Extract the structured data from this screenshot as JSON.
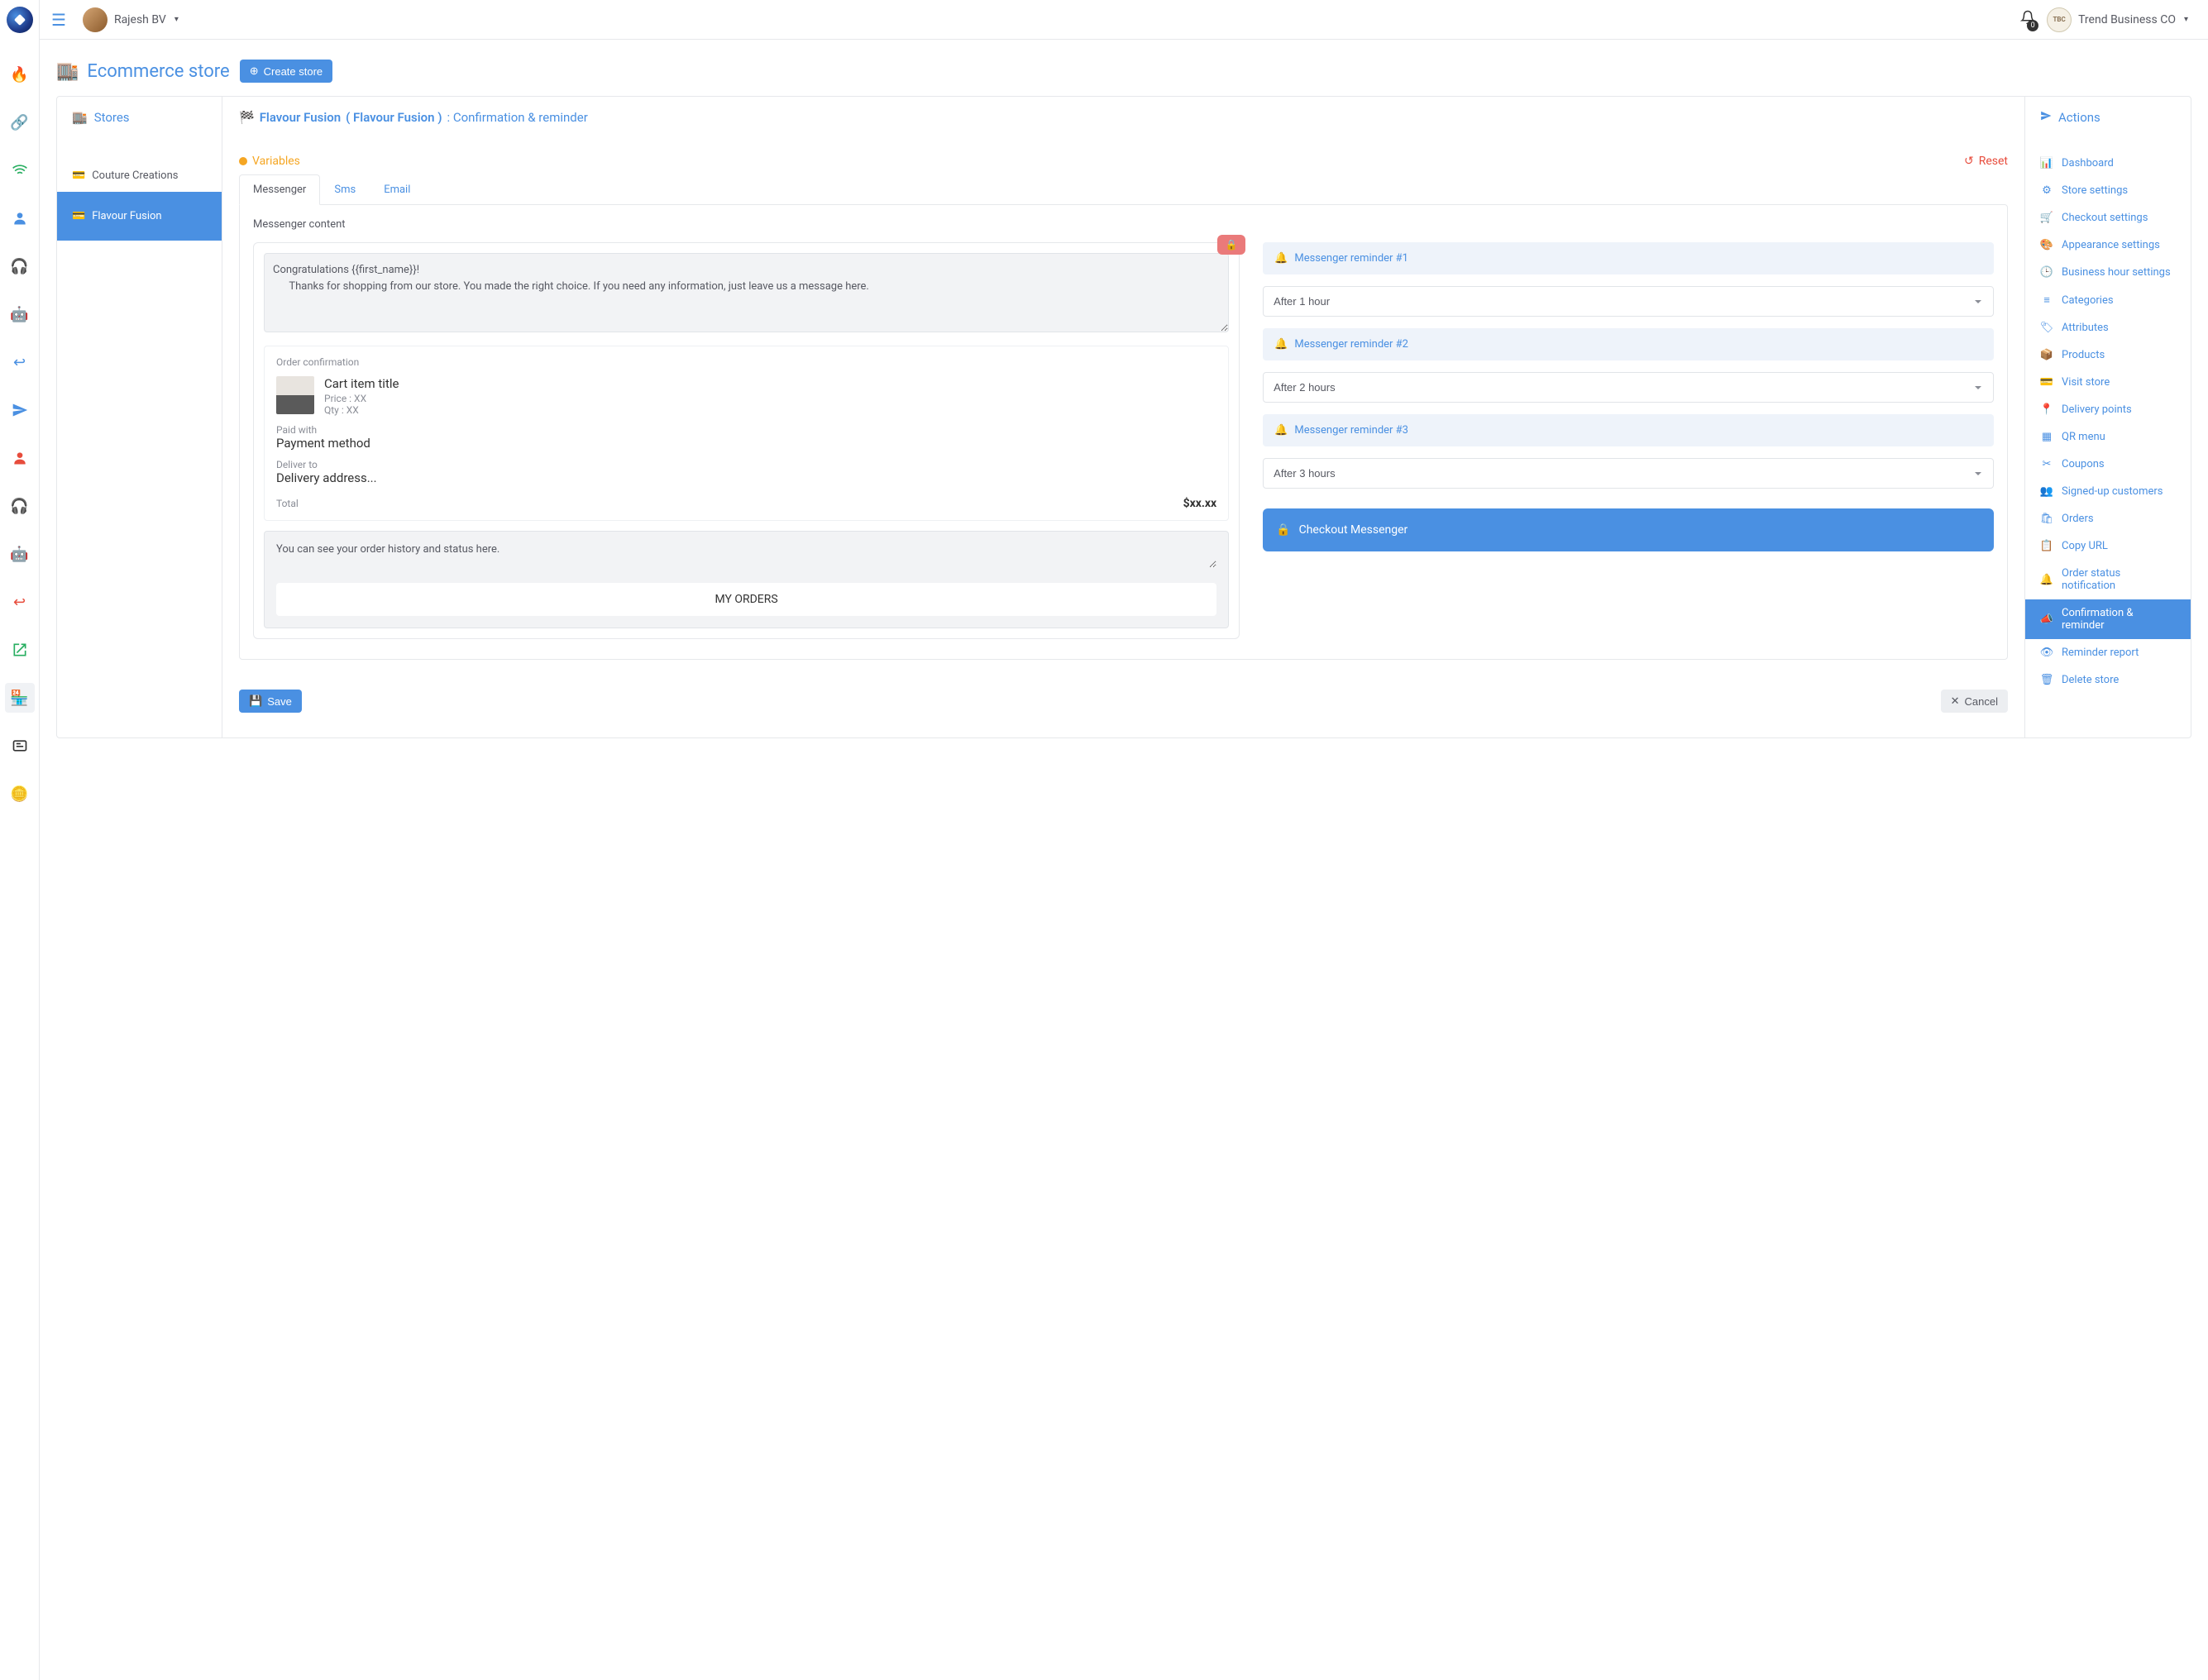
{
  "header": {
    "user_left": "Rajesh BV",
    "user_right": "Trend Business CO",
    "notif_count": "0"
  },
  "page": {
    "title": "Ecommerce store",
    "create_btn": "Create store"
  },
  "stores": {
    "title": "Stores",
    "items": [
      {
        "label": "Couture Creations",
        "active": false
      },
      {
        "label": "Flavour Fusion",
        "active": true
      }
    ]
  },
  "center": {
    "store": "Flavour Fusion",
    "store_paren": "( Flavour Fusion )",
    "section": ": Confirmation & reminder",
    "variables": "Variables",
    "reset": "Reset",
    "tabs": [
      {
        "label": "Messenger",
        "active": true
      },
      {
        "label": "Sms",
        "active": false
      },
      {
        "label": "Email",
        "active": false
      }
    ],
    "panel_title": "Messenger content",
    "message": "Congratulations {{first_name}}!\n      Thanks for shopping from our store. You made the right choice. If you need any information, just leave us a message here.",
    "order_conf_label": "Order confirmation",
    "cart_title": "Cart item title",
    "cart_price": "Price : XX",
    "cart_qty": "Qty : XX",
    "paid_with_label": "Paid with",
    "paid_with_value": "Payment method",
    "deliver_label": "Deliver to",
    "deliver_value": "Delivery address...",
    "total_label": "Total",
    "total_value": "$xx.xx",
    "history_text": "You can see your order history and status here.",
    "my_orders": "MY ORDERS",
    "reminders": [
      {
        "label": "Messenger reminder #1",
        "value": "After 1 hour"
      },
      {
        "label": "Messenger reminder #2",
        "value": "After 2 hours"
      },
      {
        "label": "Messenger reminder #3",
        "value": "After 3 hours"
      }
    ],
    "checkout_btn": "Checkout Messenger",
    "save": "Save",
    "cancel": "Cancel"
  },
  "actions": {
    "title": "Actions",
    "items": [
      {
        "icon": "📊",
        "label": "Dashboard"
      },
      {
        "icon": "⚙",
        "label": "Store settings"
      },
      {
        "icon": "🛒",
        "label": "Checkout settings"
      },
      {
        "icon": "🎨",
        "label": "Appearance settings"
      },
      {
        "icon": "🕒",
        "label": "Business hour settings"
      },
      {
        "icon": "≡",
        "label": "Categories"
      },
      {
        "icon": "🏷",
        "label": "Attributes"
      },
      {
        "icon": "📦",
        "label": "Products"
      },
      {
        "icon": "💳",
        "label": "Visit store"
      },
      {
        "icon": "📍",
        "label": "Delivery points"
      },
      {
        "icon": "▦",
        "label": "QR menu"
      },
      {
        "icon": "✂",
        "label": "Coupons"
      },
      {
        "icon": "👥",
        "label": "Signed-up customers"
      },
      {
        "icon": "🛍",
        "label": "Orders"
      },
      {
        "icon": "📋",
        "label": "Copy URL"
      },
      {
        "icon": "🔔",
        "label": "Order status notification"
      },
      {
        "icon": "📣",
        "label": "Confirmation & reminder",
        "active": true
      },
      {
        "icon": "👁",
        "label": "Reminder report"
      },
      {
        "icon": "🗑",
        "label": "Delete store"
      }
    ]
  }
}
